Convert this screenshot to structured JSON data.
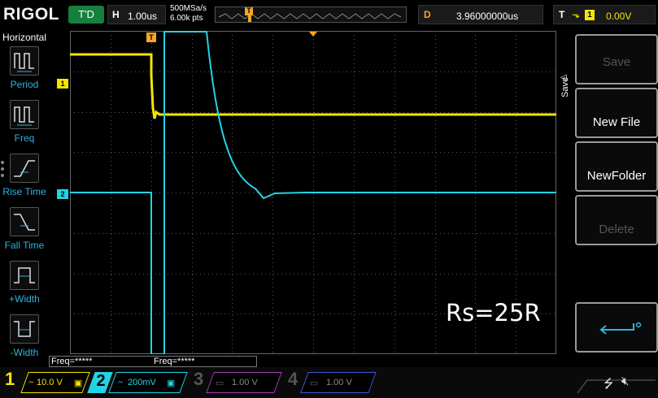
{
  "top": {
    "logo": "RIGOL",
    "trigger_status": "T'D",
    "horizontal_label": "H",
    "timebase": "1.00us",
    "sample_rate": "500MSa/s",
    "memory_depth": "6.00k pts",
    "delay_label": "D",
    "delay_value": "3.96000000us",
    "trigger_label": "T",
    "trigger_channel": "1",
    "trigger_level": "0.00V"
  },
  "left_panel": {
    "title": "Horizontal",
    "items": [
      {
        "label": "Period",
        "icon": "period-icon"
      },
      {
        "label": "Freq",
        "icon": "freq-icon"
      },
      {
        "label": "Rise Time",
        "icon": "rise-time-icon"
      },
      {
        "label": "Fall Time",
        "icon": "fall-time-icon"
      },
      {
        "label": "+Width",
        "icon": "positive-width-icon"
      },
      {
        "label": "-Width",
        "icon": "negative-width-icon"
      }
    ]
  },
  "screen": {
    "annotation": "Rs=25R",
    "ch1_marker": "1",
    "ch2_marker": "2",
    "trigger_marker": "T",
    "freq_ch1": "Freq=*****",
    "freq_ch2": "Freq=*****",
    "colors": {
      "ch1": "#f2e600",
      "ch2": "#22d3e6",
      "grid": "#5a5a5a",
      "trigger": "#f5a623"
    }
  },
  "right_panel": {
    "menu_title": "Save",
    "softkeys": [
      {
        "label": "Save",
        "enabled": false
      },
      {
        "label": "New File",
        "enabled": true
      },
      {
        "label": "NewFolder",
        "enabled": true
      },
      {
        "label": "Delete",
        "enabled": false
      },
      {
        "label": "",
        "enabled": true,
        "icon": "return-icon"
      }
    ]
  },
  "bottom": {
    "channels": [
      {
        "num": "1",
        "coupling": "~",
        "scale": "10.0 V",
        "color": "#f2e600",
        "active": true
      },
      {
        "num": "2",
        "coupling": "~",
        "scale": "200mV",
        "color": "#22d3e6",
        "active": true
      },
      {
        "num": "3",
        "coupling": "",
        "scale": "1.00 V",
        "color": "#a03fb3",
        "active": false
      },
      {
        "num": "4",
        "coupling": "",
        "scale": "1.00 V",
        "color": "#3b5bd6",
        "active": false
      }
    ]
  }
}
